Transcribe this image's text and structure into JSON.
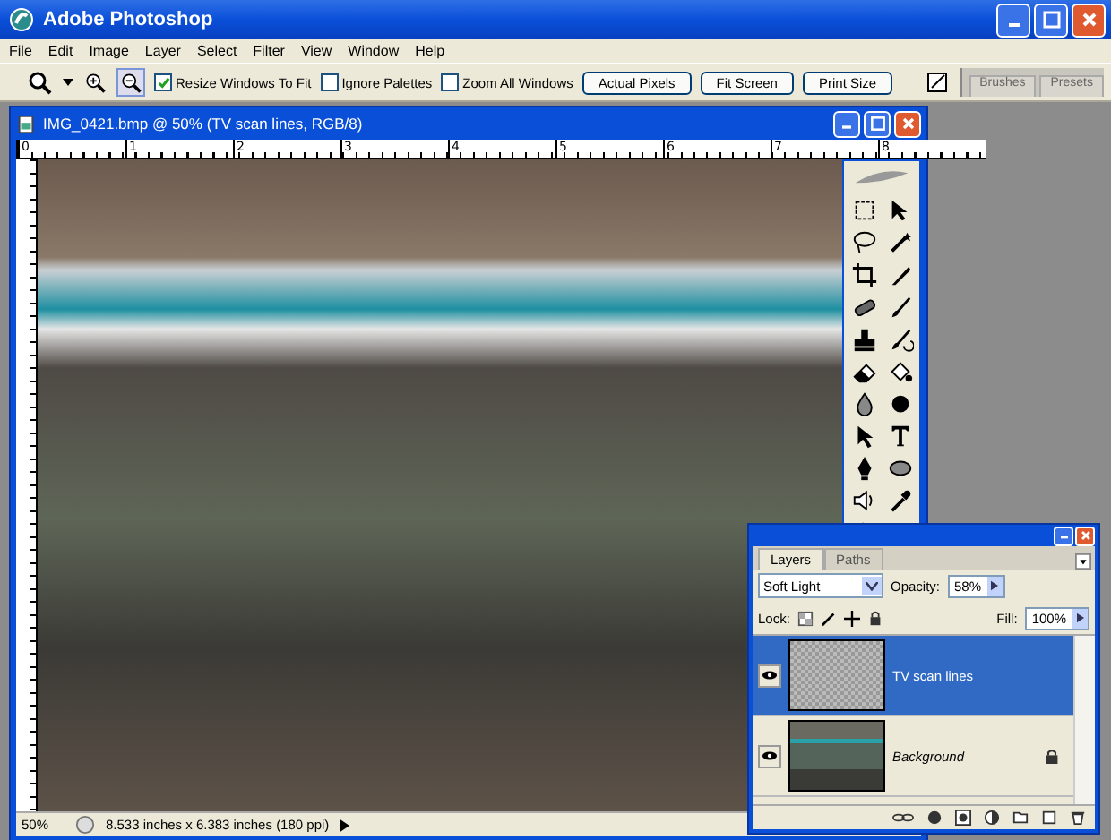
{
  "app": {
    "title": "Adobe Photoshop"
  },
  "menu": [
    "File",
    "Edit",
    "Image",
    "Layer",
    "Select",
    "Filter",
    "View",
    "Window",
    "Help"
  ],
  "options_bar": {
    "checkboxes": [
      {
        "label": "Resize Windows To Fit",
        "checked": true
      },
      {
        "label": "Ignore Palettes",
        "checked": false
      },
      {
        "label": "Zoom All Windows",
        "checked": false
      }
    ],
    "buttons": [
      "Actual Pixels",
      "Fit Screen",
      "Print Size"
    ],
    "palette_well_tabs": [
      "Brushes",
      "Presets"
    ]
  },
  "document": {
    "title": "IMG_0421.bmp @ 50% (TV scan lines, RGB/8)",
    "ruler_labels": [
      "0",
      "1",
      "2",
      "3",
      "4",
      "5",
      "6",
      "7",
      "8"
    ],
    "zoom": "50%",
    "status": "8.533 inches x 6.383 inches (180 ppi)"
  },
  "layers_panel": {
    "tabs": [
      {
        "label": "Layers",
        "selected": true
      },
      {
        "label": "Paths",
        "selected": false
      }
    ],
    "blend_mode": "Soft Light",
    "opacity_label": "Opacity:",
    "opacity": "58%",
    "lock_label": "Lock:",
    "fill_label": "Fill:",
    "fill": "100%",
    "layers": [
      {
        "name": "TV scan lines",
        "selected": true,
        "visible": true,
        "locked": false,
        "kind": "pattern"
      },
      {
        "name": "Background",
        "selected": false,
        "visible": true,
        "locked": true,
        "kind": "photo"
      }
    ]
  }
}
